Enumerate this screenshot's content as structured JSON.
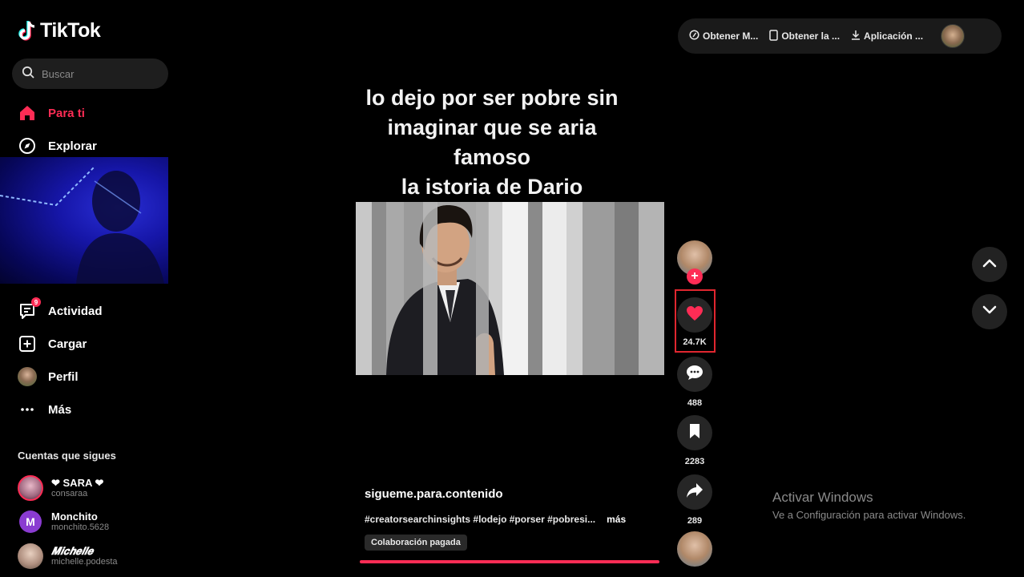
{
  "app": {
    "name": "TikTok"
  },
  "search": {
    "placeholder": "Buscar"
  },
  "nav": {
    "para_ti": "Para ti",
    "explorar": "Explorar",
    "actividad": "Actividad",
    "actividad_badge": "9",
    "cargar": "Cargar",
    "perfil": "Perfil",
    "mas": "Más"
  },
  "following": {
    "title": "Cuentas que sigues",
    "accounts": [
      {
        "name": "❤ SARA ❤",
        "handle": "consaraa"
      },
      {
        "name": "Monchito",
        "handle": "monchito.5628",
        "initial": "M"
      },
      {
        "name": "𝑴𝒊𝒄𝒉𝒆𝒍𝒍𝒆",
        "handle": "michelle.podesta"
      }
    ]
  },
  "top_bar": {
    "item1": "Obtener M...",
    "item2": "Obtener la ...",
    "item3": "Aplicación ..."
  },
  "video": {
    "caption_title": "lo dejo por ser pobre sin\nimaginar que se aria\nfamoso\nla istoria de Dario",
    "author": "sigueme.para.contenido",
    "description": "#creatorsearchinsights #lodejo #porser #pobresi...",
    "more": "más",
    "tag": "Colaboración pagada"
  },
  "actions": {
    "likes": "24.7K",
    "comments": "488",
    "saves": "2283",
    "shares": "289"
  },
  "watermark": {
    "line1": "Activar Windows",
    "line2": "Ve a Configuración para activar Windows."
  },
  "colors": {
    "accent": "#fe2c55",
    "background": "#000000",
    "highlight_box": "#e0262f"
  }
}
